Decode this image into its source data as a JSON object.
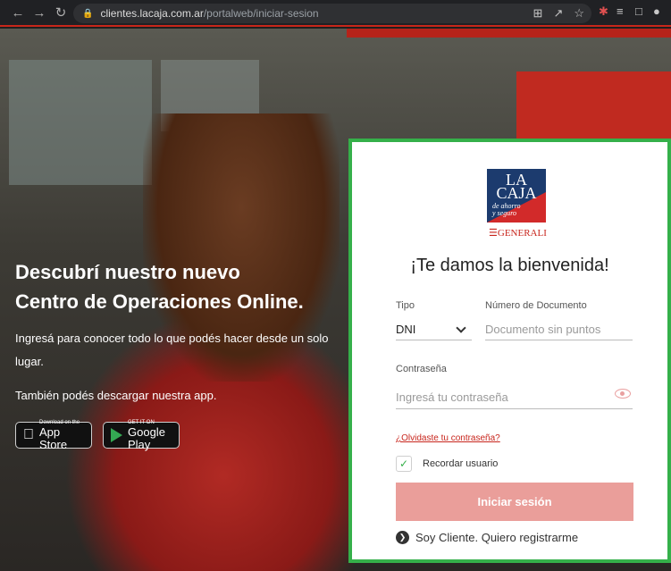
{
  "browser": {
    "url_host": "clientes.lacaja.com.ar",
    "url_path": "/portalweb/iniciar-sesion"
  },
  "hero": {
    "headline_line1": "Descubrí nuestro nuevo",
    "headline_line2": "Centro de Operaciones Online.",
    "subtext": "Ingresá para conocer todo lo que podés hacer desde un solo lugar.",
    "app_line": "También podés descargar nuestra app.",
    "appstore_small": "Download on the",
    "appstore_big": "App Store",
    "gplay_small": "GET IT ON",
    "gplay_big": "Google Play"
  },
  "logo": {
    "line1": "LA",
    "line2": "CAJA",
    "line3": "de ahorro",
    "line4": "y seguro",
    "brand": "GENERALI"
  },
  "login": {
    "welcome": "¡Te damos la bienvenida!",
    "tipo_label": "Tipo",
    "tipo_value": "DNI",
    "doc_label": "Número de Documento",
    "doc_placeholder": "Documento sin puntos",
    "pass_label": "Contraseña",
    "pass_placeholder": "Ingresá tu contraseña",
    "forgot": "¿Olvidaste tu contraseña?",
    "remember": "Recordar usuario",
    "remember_checked": true,
    "submit": "Iniciar sesión",
    "register": "Soy Cliente. Quiero registrarme"
  },
  "colors": {
    "accent_red": "#c8251c",
    "button_disabled": "#ea9e9a",
    "focus_green": "#35b04a"
  }
}
